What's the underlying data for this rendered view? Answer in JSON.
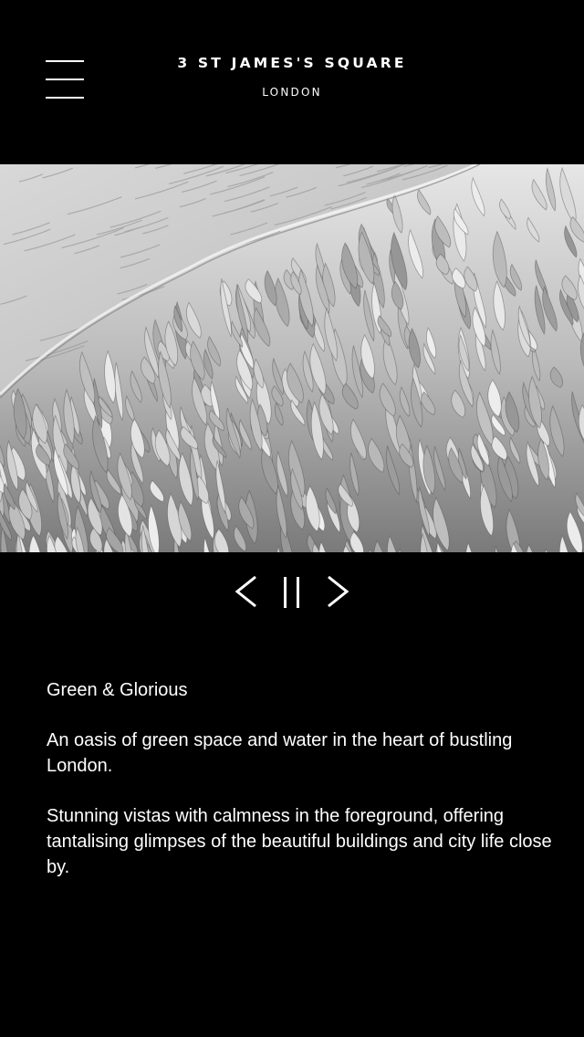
{
  "header": {
    "title": "3 ST JAMES'S SQUARE",
    "subtitle": "LONDON",
    "menu_icon": "hamburger-menu-icon"
  },
  "hero": {
    "image": "black-and-white feathers photograph"
  },
  "slideshow_controls": {
    "previous_icon": "chevron-left-icon",
    "pause_icon": "pause-icon",
    "next_icon": "chevron-right-icon"
  },
  "content": {
    "heading": "Green & Glorious",
    "paragraph_1": "An oasis of green space and water in the heart of bustling London.",
    "paragraph_2": "Stunning vistas with calmness in the foreground, offering tantalising glimpses of the beautiful buildings and city life close by."
  },
  "colors": {
    "background": "#000000",
    "text": "#ffffff"
  }
}
